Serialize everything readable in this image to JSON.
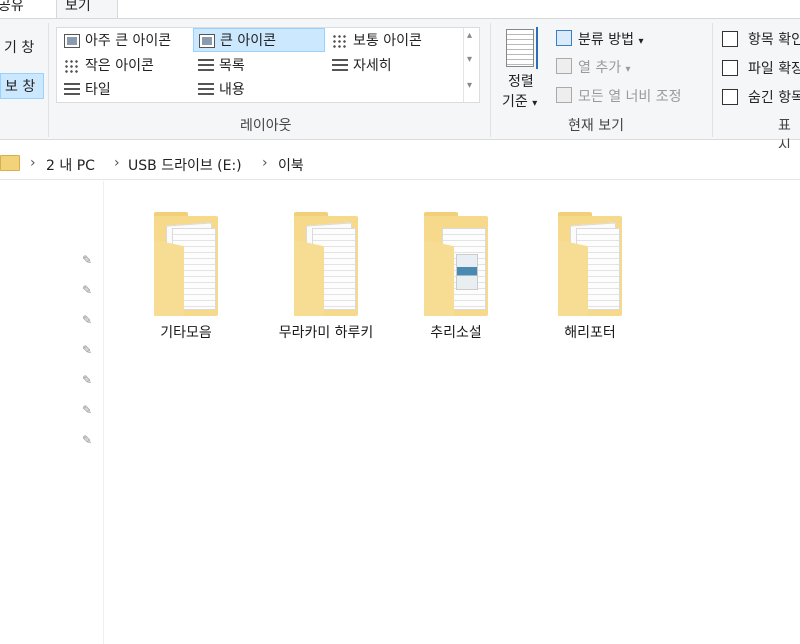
{
  "tabs": {
    "share": "공유",
    "view": "보기"
  },
  "pane": {
    "item1": "기 창",
    "item2": "보 창"
  },
  "layout": {
    "group_label": "레이아웃",
    "items": [
      {
        "label": "아주 큰 아이콘",
        "icon": "extra-large-icons-icon",
        "selected": false
      },
      {
        "label": "큰 아이콘",
        "icon": "large-icons-icon",
        "selected": true
      },
      {
        "label": "보통 아이콘",
        "icon": "medium-icons-icon",
        "selected": false
      },
      {
        "label": "작은 아이콘",
        "icon": "small-icons-icon",
        "selected": false
      },
      {
        "label": "목록",
        "icon": "list-icon",
        "selected": false
      },
      {
        "label": "자세히",
        "icon": "details-icon",
        "selected": false
      },
      {
        "label": "타일",
        "icon": "tiles-icon",
        "selected": false
      },
      {
        "label": "내용",
        "icon": "content-icon",
        "selected": false
      }
    ]
  },
  "current_view": {
    "group_label": "현재 보기",
    "sort_line1": "정렬",
    "sort_line2": "기준",
    "group_by": "분류 방법",
    "add_columns": "열 추가",
    "size_columns": "모든 열 너비 조정"
  },
  "show_hide": {
    "group_label": "표시",
    "checkbox1": "항목 확인",
    "checkbox2": "파일 확장",
    "checkbox3": "숨긴 항목"
  },
  "address": {
    "crumbs": [
      "2 내 PC",
      "USB 드라이브 (E:)",
      "이북"
    ]
  },
  "files": [
    {
      "name": "기타모음"
    },
    {
      "name": "무라카미 하루키"
    },
    {
      "name": "추리소설"
    },
    {
      "name": "해리포터"
    }
  ],
  "colors": {
    "accent": "#cce8ff",
    "accent_border": "#99d1ff",
    "folder": "#f6d98b"
  }
}
